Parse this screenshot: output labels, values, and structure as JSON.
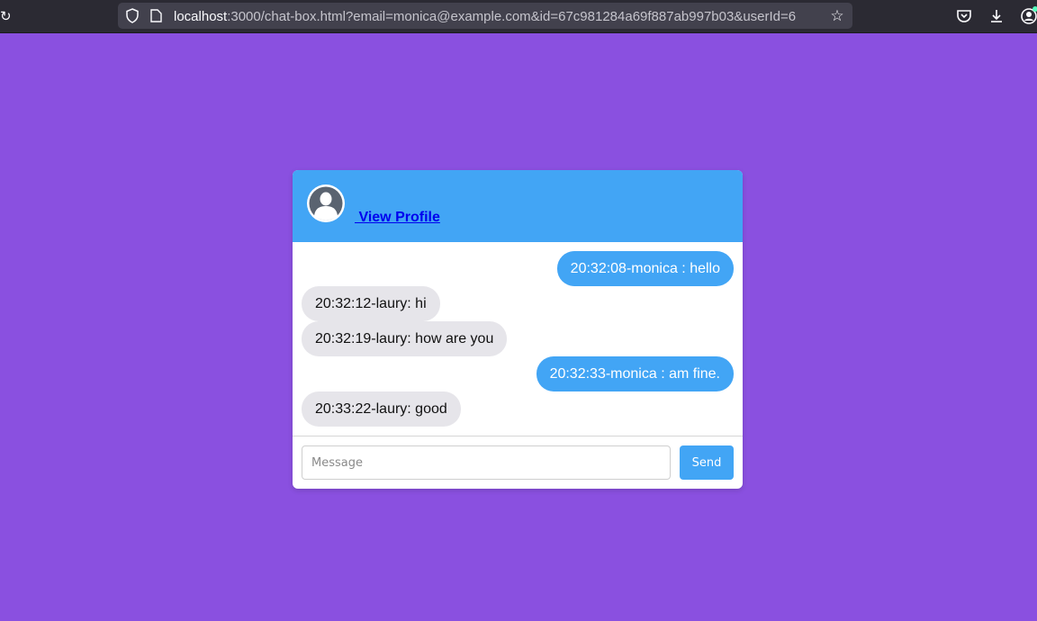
{
  "browser": {
    "url_host": "localhost",
    "url_rest": ":3000/chat-box.html?email=monica@example.com&id=67c981284a69f887ab997b03&userId=6"
  },
  "header": {
    "avatar_icon": "user-avatar-icon",
    "profile_link": " View Profile"
  },
  "messages": [
    {
      "side": "sent",
      "text": "20:32:08-monica : hello"
    },
    {
      "side": "recv",
      "text": "20:32:12-laury: hi"
    },
    {
      "side": "recv",
      "text": "20:32:19-laury: how are you"
    },
    {
      "side": "sent",
      "text": "20:32:33-monica : am fine."
    },
    {
      "side": "recv",
      "text": "20:33:22-laury: good"
    }
  ],
  "composer": {
    "placeholder": "Message",
    "value": "",
    "send_label": "Send"
  },
  "colors": {
    "background": "#8a50e0",
    "accent": "#42a5f5",
    "received_bubble": "#e6e5ea"
  }
}
